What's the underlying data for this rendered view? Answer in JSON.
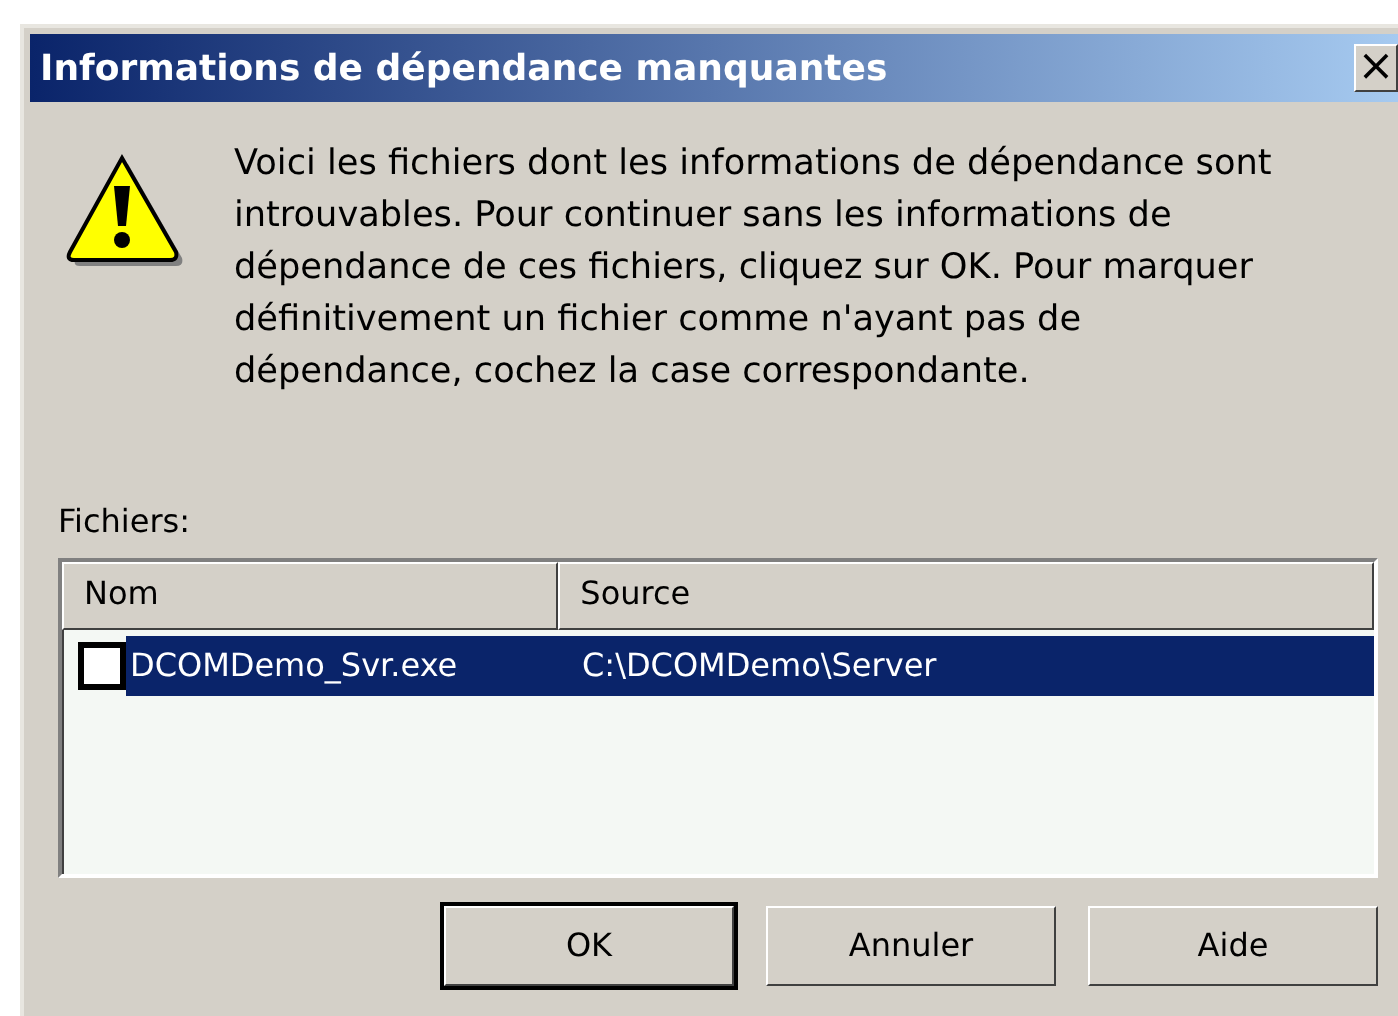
{
  "window": {
    "title": "Informations de dépendance manquantes",
    "close_glyph": "×"
  },
  "message": {
    "lines": [
      "Voici les fichiers dont les informations de dépendance sont",
      "introuvables. Pour continuer sans les informations de",
      "dépendance de ces fichiers, cliquez sur OK. Pour marquer",
      "définitivement un fichier comme n'ayant pas de",
      "dépendance, cochez la case correspondante."
    ]
  },
  "files_label": "Fichiers:",
  "table": {
    "columns": [
      "Nom",
      "Source"
    ],
    "rows": [
      {
        "checked": false,
        "selected": true,
        "cells": [
          "DCOMDemo_Svr.exe",
          "C:\\DCOMDemo\\Server"
        ]
      }
    ]
  },
  "buttons": [
    {
      "label": "OK",
      "default": true
    },
    {
      "label": "Annuler",
      "default": false
    },
    {
      "label": "Aide",
      "default": false
    }
  ]
}
